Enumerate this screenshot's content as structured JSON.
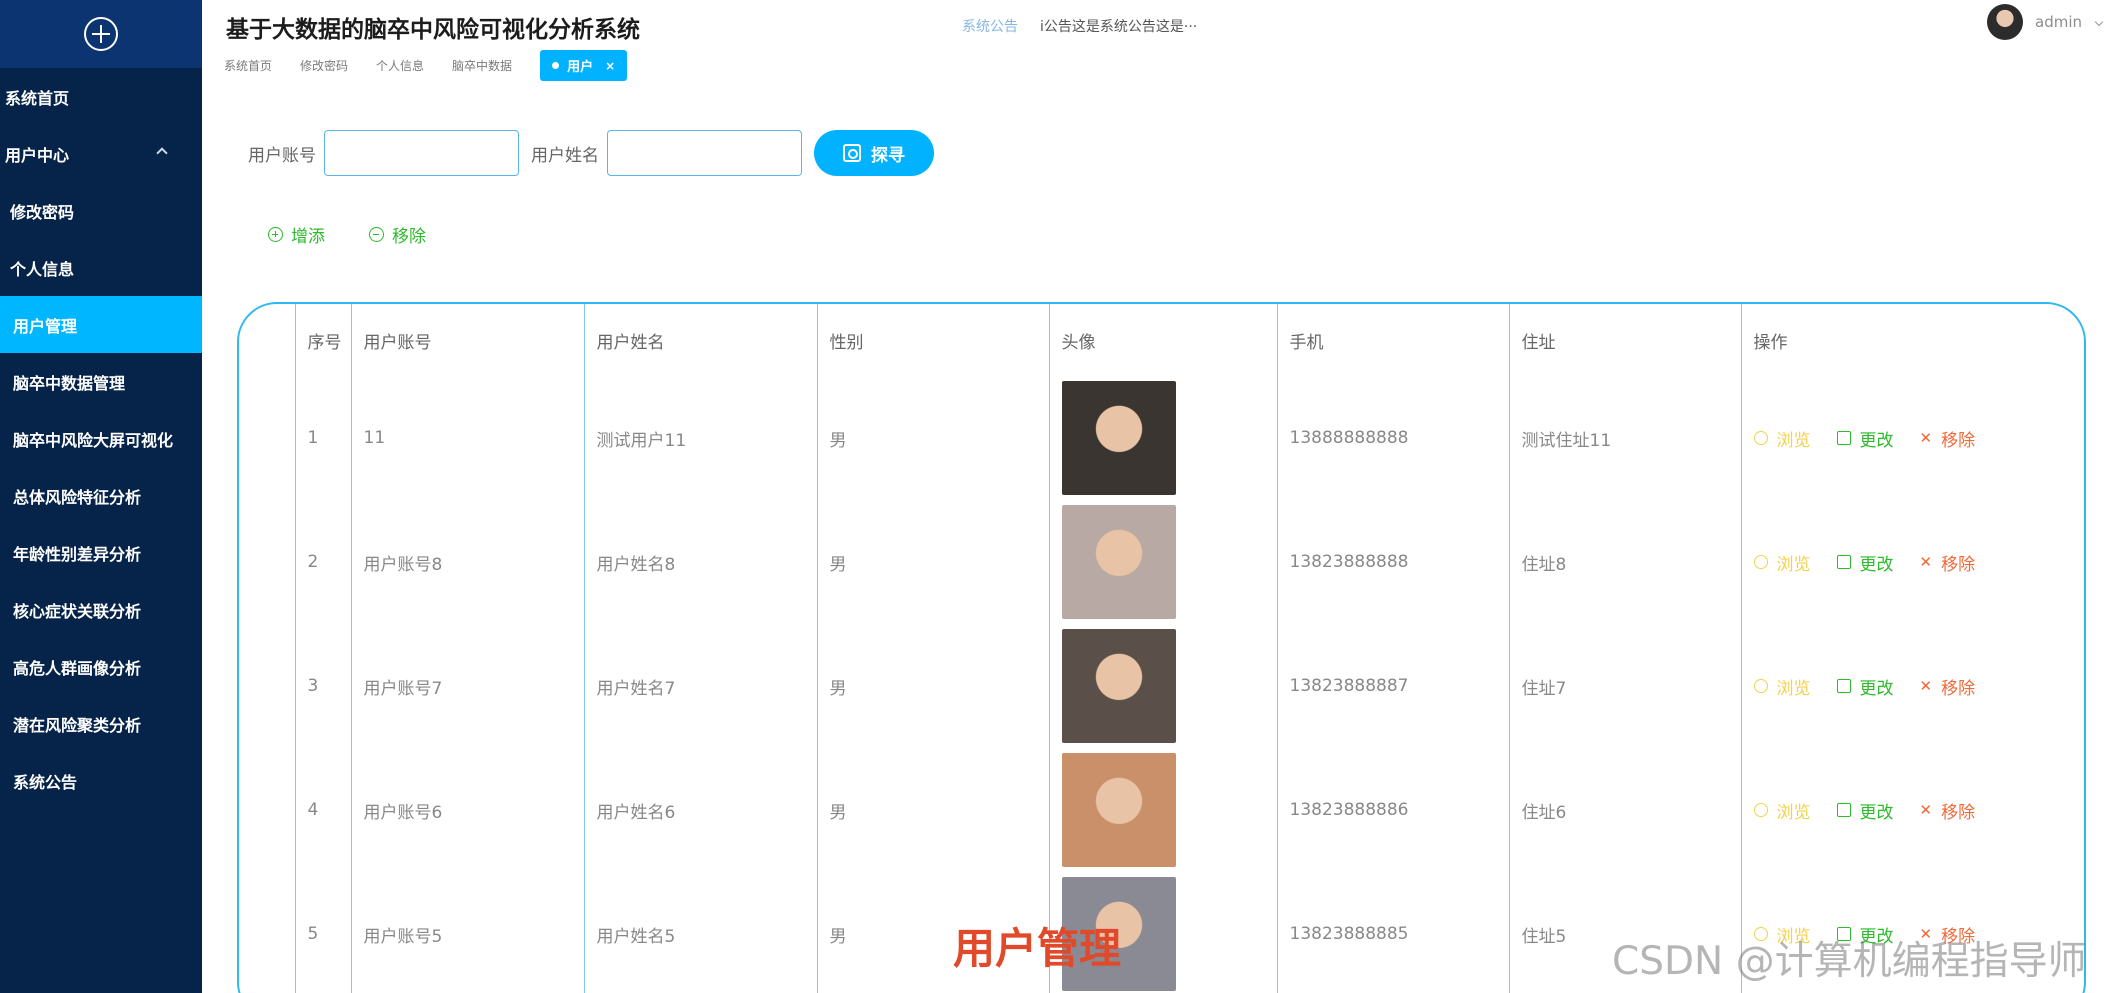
{
  "sidebar": {
    "items": [
      {
        "label": "系统首页"
      },
      {
        "label": "用户中心"
      },
      {
        "label": "修改密码"
      },
      {
        "label": "个人信息"
      },
      {
        "label": "用户管理"
      },
      {
        "label": "脑卒中数据管理"
      },
      {
        "label": "脑卒中风险大屏可视化"
      },
      {
        "label": "总体风险特征分析"
      },
      {
        "label": "年龄性别差异分析"
      },
      {
        "label": "核心症状关联分析"
      },
      {
        "label": "高危人群画像分析"
      },
      {
        "label": "潜在风险聚类分析"
      },
      {
        "label": "系统公告"
      }
    ]
  },
  "header": {
    "title": "基于大数据的脑卒中风险可视化分析系统",
    "notice_label": "系统公告",
    "notice_text": "i公告这是系统公告这是···",
    "user_name": "admin"
  },
  "tabs": [
    {
      "label": "系统首页"
    },
    {
      "label": "修改密码"
    },
    {
      "label": "个人信息"
    },
    {
      "label": "脑卒中数据"
    }
  ],
  "active_tab": {
    "label": "用户",
    "close": "×"
  },
  "search": {
    "account_label": "用户账号",
    "name_label": "用户姓名",
    "button_label": "探寻"
  },
  "actions": {
    "add_label": "增添",
    "remove_label": "移除"
  },
  "table": {
    "headers": [
      "序号",
      "用户账号",
      "用户姓名",
      "性别",
      "头像",
      "手机",
      "住址",
      "操作"
    ],
    "ops": {
      "view": "浏览",
      "edit": "更改",
      "delete": "移除"
    },
    "rows": [
      {
        "index": "1",
        "account": "11",
        "name": "测试用户11",
        "gender": "男",
        "phone": "13888888888",
        "address": "测试住址11",
        "avatar_color": "#3a3530"
      },
      {
        "index": "2",
        "account": "用户账号8",
        "name": "用户姓名8",
        "gender": "男",
        "phone": "13823888888",
        "address": "住址8",
        "avatar_color": "#b8a9a4"
      },
      {
        "index": "3",
        "account": "用户账号7",
        "name": "用户姓名7",
        "gender": "男",
        "phone": "13823888887",
        "address": "住址7",
        "avatar_color": "#5b4f49"
      },
      {
        "index": "4",
        "account": "用户账号6",
        "name": "用户姓名6",
        "gender": "男",
        "phone": "13823888886",
        "address": "住址6",
        "avatar_color": "#c9906a"
      },
      {
        "index": "5",
        "account": "用户账号5",
        "name": "用户姓名5",
        "gender": "男",
        "phone": "13823888885",
        "address": "住址5",
        "avatar_color": "#8a8a94"
      }
    ]
  },
  "overlay": {
    "caption": "用户管理",
    "watermark": "CSDN @计算机编程指导师"
  },
  "colors": {
    "sidebar": "#06244a",
    "accent": "#00b2ff",
    "green": "#2bbb2b",
    "yellow": "#f3d24a",
    "red": "#f06a3a"
  }
}
